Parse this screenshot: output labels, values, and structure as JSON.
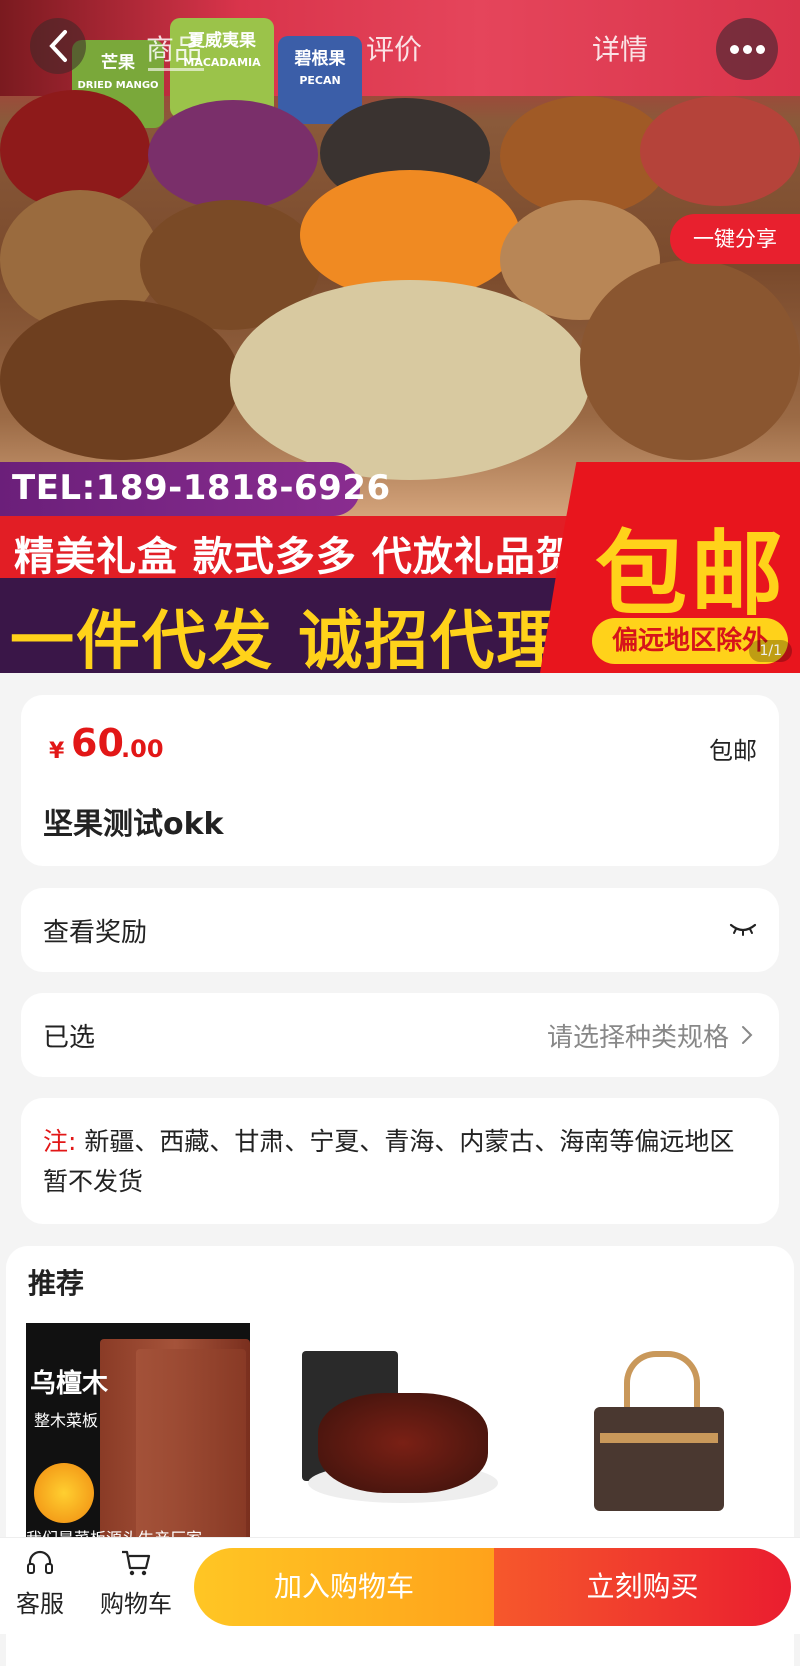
{
  "header": {
    "tabs": [
      {
        "label": "商品",
        "active": true
      },
      {
        "label": "评价",
        "active": false
      },
      {
        "label": "详情",
        "active": false
      }
    ]
  },
  "banner": {
    "share_label": "一键分享",
    "tel_text": "TEL:189-1818-6926",
    "line1": "精美礼盒  款式多多  代放礼品贺卡",
    "line2": "一件代发 诚招代理",
    "free_shipping": "包邮",
    "remote_note": "偏远地区除外",
    "bag_labels": [
      "芒果",
      "夏威夷果",
      "碧根果"
    ],
    "bag_sublabels": [
      "DRIED MANGO",
      "MACADAMIA",
      "PECAN"
    ],
    "image_index": "1/1"
  },
  "product": {
    "currency": "¥",
    "price_int": "60",
    "price_dec": ".00",
    "shipping": "包邮",
    "title": "坚果测试okk"
  },
  "reward": {
    "label": "查看奖励"
  },
  "spec": {
    "label": "已选",
    "value": "请选择种类规格"
  },
  "note": {
    "prefix": "注:",
    "text": " 新疆、西藏、甘肃、宁夏、青海、内蒙古、海南等偏远地区暂不发货"
  },
  "recommend": {
    "title": "推荐",
    "items": [
      {
        "title": "乌檀木",
        "subtitle": "整木菜板",
        "caption": "我们是菜板源头生产厂家"
      },
      {
        "title": "",
        "subtitle": "",
        "caption": ""
      },
      {
        "title": "",
        "subtitle": "",
        "caption": ""
      }
    ]
  },
  "bottom_bar": {
    "service_label": "客服",
    "cart_label": "购物车",
    "add_cart_label": "加入购物车",
    "buy_now_label": "立刻购买"
  },
  "colors": {
    "price_red": "#e21717",
    "add_cart_orange": "#ffb020",
    "buy_now_red": "#ea1d2f",
    "page_bg": "#f4f4f4"
  }
}
